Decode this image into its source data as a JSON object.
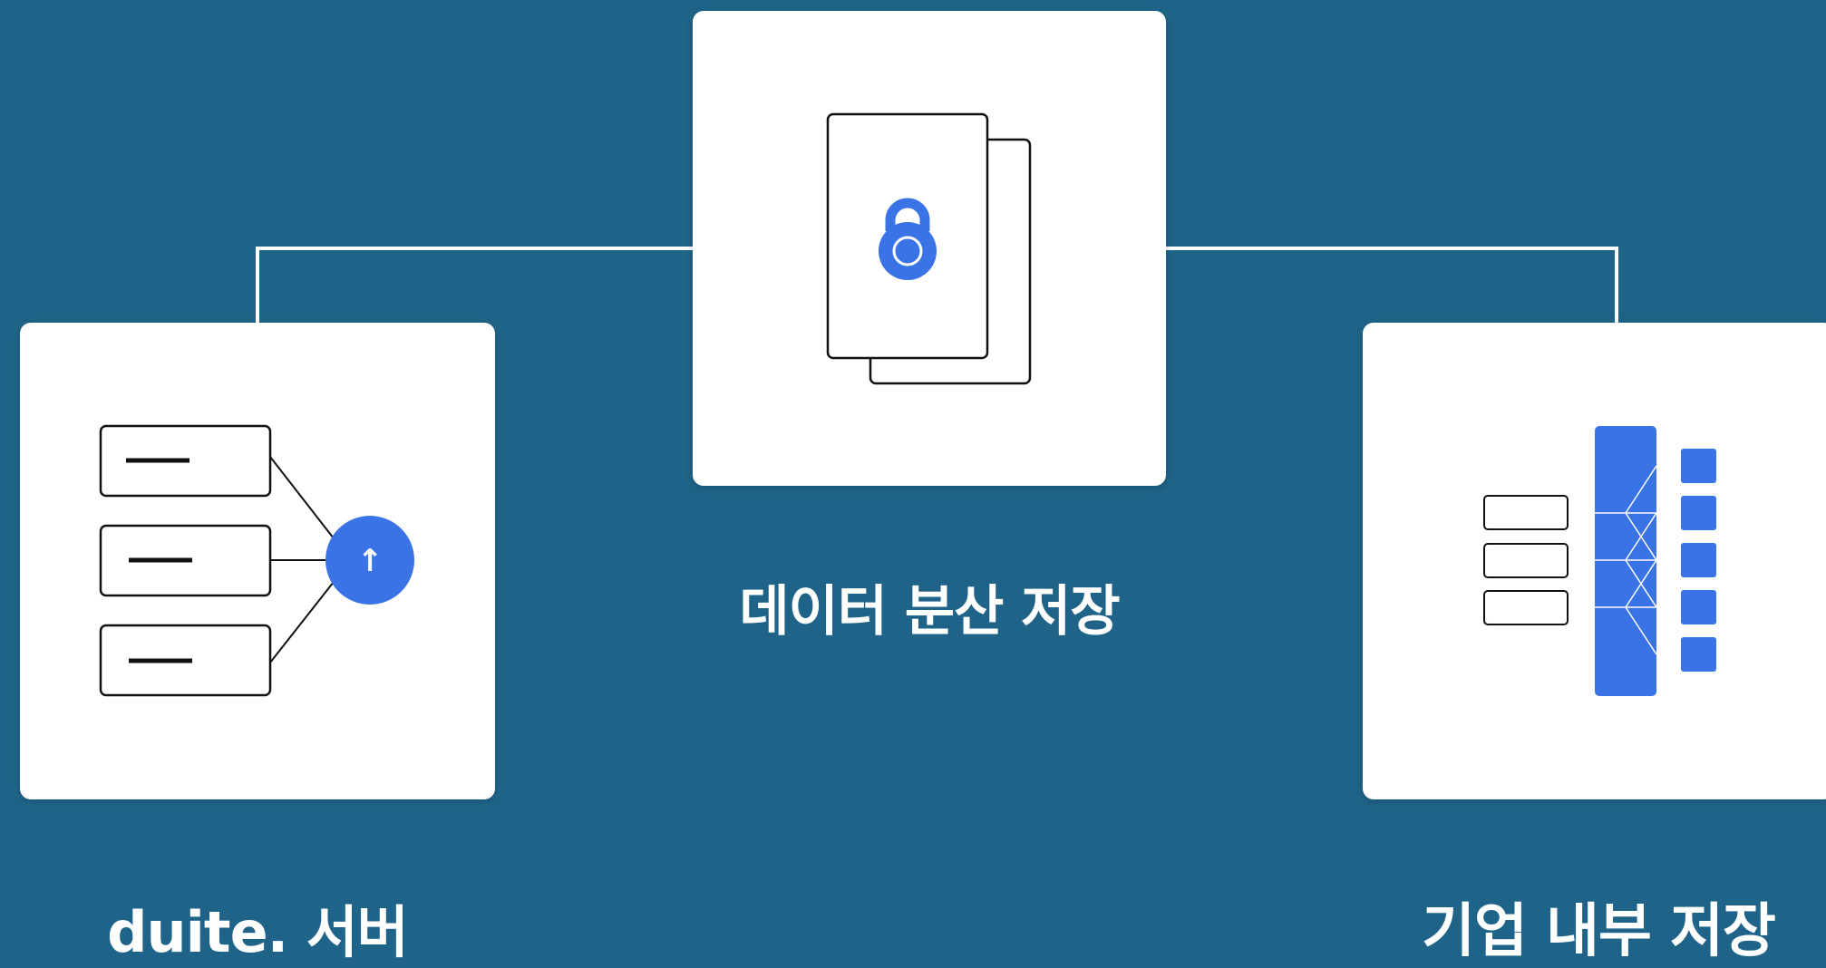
{
  "colors": {
    "background": "#1f6488",
    "card": "#ffffff",
    "accent": "#3a73e6",
    "stroke": "#111111",
    "connector": "#ffffff"
  },
  "nodes": {
    "center": {
      "label": "데이터 분산 저장",
      "icon": "encrypted-document-icon"
    },
    "left": {
      "label": "duite. 서버",
      "icon": "server-upload-icon"
    },
    "right": {
      "label": "기업 내부 저장",
      "icon": "distribution-network-icon"
    }
  },
  "upload_glyph": "↑"
}
